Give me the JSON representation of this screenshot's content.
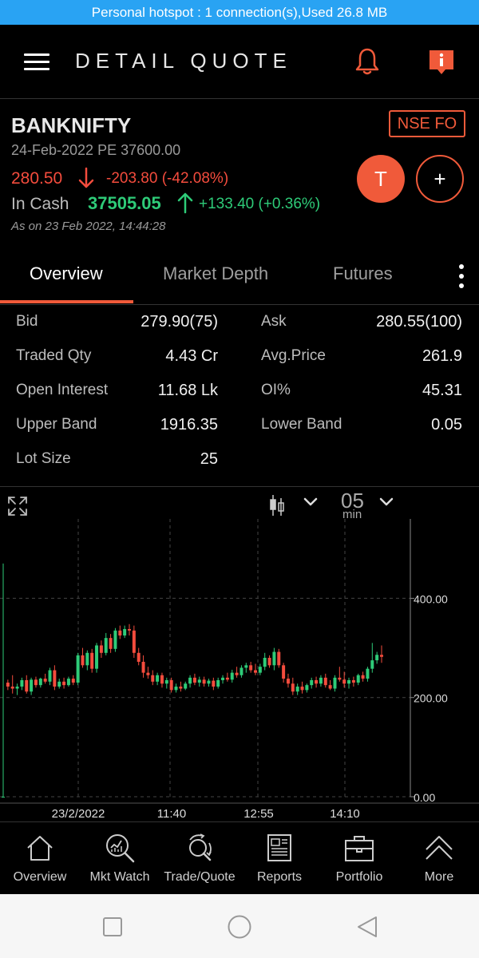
{
  "status_bar": {
    "text": "Personal hotspot : 1 connection(s),Used  26.8 MB"
  },
  "app_bar": {
    "title": "DETAIL QUOTE",
    "accent_color": "#f05a3a"
  },
  "quote": {
    "symbol": "BANKNIFTY",
    "contract": "24-Feb-2022 PE 37600.00",
    "exchange": "NSE FO",
    "ltp": "280.50",
    "ltp_change": "-203.80 (-42.08%)",
    "cash_label": "In Cash",
    "cash_price": "37505.05",
    "cash_change": "+133.40 (+0.36%)",
    "as_on": "As on 23 Feb 2022, 14:44:28",
    "trade_button": "T",
    "add_button": "+"
  },
  "tabs": [
    {
      "label": "Overview",
      "active": true
    },
    {
      "label": "Market Depth",
      "active": false
    },
    {
      "label": "Futures",
      "active": false
    }
  ],
  "stats": [
    {
      "l_label": "Bid",
      "l_value": "279.90(75)",
      "r_label": "Ask",
      "r_value": "280.55(100)"
    },
    {
      "l_label": "Traded Qty",
      "l_value": "4.43 Cr",
      "r_label": "Avg.Price",
      "r_value": "261.9"
    },
    {
      "l_label": "Open Interest",
      "l_value": "11.68 Lk",
      "r_label": "OI%",
      "r_value": "45.31"
    },
    {
      "l_label": "Upper Band",
      "l_value": "1916.35",
      "r_label": "Lower Band",
      "r_value": "0.05"
    },
    {
      "l_label": "Lot Size",
      "l_value": "25",
      "r_label": "",
      "r_value": ""
    }
  ],
  "chart_controls": {
    "interval": "05",
    "interval_unit": "min"
  },
  "chart_data": {
    "type": "candlestick",
    "y_ticks": [
      "400.00",
      "200.00",
      "0.00"
    ],
    "ylim": [
      0,
      560
    ],
    "x_tick_labels": [
      "23/2/2022",
      "11:40",
      "12:55",
      "14:10"
    ],
    "grid": true,
    "up_color": "#2ecb78",
    "down_color": "#f44c3d",
    "candles": [
      [
        0,
        470,
        0,
        0
      ],
      [
        230,
        236,
        215,
        222
      ],
      [
        222,
        245,
        208,
        218
      ],
      [
        218,
        228,
        205,
        222
      ],
      [
        222,
        240,
        215,
        235
      ],
      [
        235,
        245,
        208,
        212
      ],
      [
        212,
        240,
        205,
        236
      ],
      [
        236,
        242,
        220,
        225
      ],
      [
        225,
        240,
        220,
        238
      ],
      [
        238,
        248,
        228,
        232
      ],
      [
        232,
        260,
        225,
        255
      ],
      [
        255,
        265,
        215,
        222
      ],
      [
        222,
        238,
        218,
        232
      ],
      [
        232,
        240,
        218,
        225
      ],
      [
        225,
        242,
        222,
        238
      ],
      [
        238,
        245,
        225,
        230
      ],
      [
        230,
        290,
        225,
        285
      ],
      [
        285,
        300,
        260,
        265
      ],
      [
        265,
        295,
        255,
        290
      ],
      [
        290,
        298,
        250,
        258
      ],
      [
        258,
        310,
        250,
        305
      ],
      [
        305,
        315,
        280,
        290
      ],
      [
        290,
        330,
        285,
        320
      ],
      [
        320,
        328,
        290,
        298
      ],
      [
        298,
        340,
        292,
        335
      ],
      [
        335,
        345,
        318,
        325
      ],
      [
        325,
        345,
        320,
        338
      ],
      [
        338,
        348,
        325,
        335
      ],
      [
        335,
        345,
        280,
        290
      ],
      [
        290,
        300,
        265,
        272
      ],
      [
        272,
        285,
        240,
        250
      ],
      [
        250,
        262,
        238,
        245
      ],
      [
        245,
        255,
        225,
        232
      ],
      [
        232,
        250,
        225,
        245
      ],
      [
        245,
        250,
        220,
        228
      ],
      [
        228,
        240,
        218,
        235
      ],
      [
        235,
        240,
        210,
        215
      ],
      [
        215,
        228,
        210,
        222
      ],
      [
        222,
        232,
        212,
        218
      ],
      [
        218,
        232,
        215,
        228
      ],
      [
        228,
        245,
        220,
        240
      ],
      [
        240,
        248,
        225,
        230
      ],
      [
        230,
        242,
        222,
        236
      ],
      [
        236,
        242,
        222,
        228
      ],
      [
        228,
        238,
        222,
        234
      ],
      [
        234,
        240,
        215,
        222
      ],
      [
        222,
        240,
        218,
        235
      ],
      [
        235,
        245,
        228,
        240
      ],
      [
        240,
        250,
        232,
        236
      ],
      [
        236,
        256,
        230,
        250
      ],
      [
        250,
        262,
        240,
        245
      ],
      [
        245,
        265,
        240,
        260
      ],
      [
        260,
        270,
        250,
        265
      ],
      [
        265,
        272,
        250,
        255
      ],
      [
        255,
        268,
        245,
        250
      ],
      [
        250,
        268,
        245,
        262
      ],
      [
        262,
        290,
        255,
        280
      ],
      [
        280,
        285,
        260,
        265
      ],
      [
        265,
        300,
        255,
        292
      ],
      [
        292,
        298,
        260,
        265
      ],
      [
        265,
        270,
        230,
        238
      ],
      [
        238,
        248,
        220,
        228
      ],
      [
        228,
        240,
        205,
        212
      ],
      [
        212,
        228,
        205,
        222
      ],
      [
        222,
        232,
        208,
        215
      ],
      [
        215,
        228,
        210,
        225
      ],
      [
        225,
        240,
        218,
        235
      ],
      [
        235,
        242,
        220,
        228
      ],
      [
        228,
        245,
        222,
        240
      ],
      [
        240,
        248,
        220,
        225
      ],
      [
        225,
        235,
        215,
        218
      ],
      [
        218,
        245,
        212,
        240
      ],
      [
        240,
        262,
        232,
        236
      ],
      [
        236,
        252,
        220,
        228
      ],
      [
        228,
        240,
        218,
        235
      ],
      [
        235,
        242,
        222,
        230
      ],
      [
        230,
        248,
        225,
        245
      ],
      [
        245,
        252,
        232,
        238
      ],
      [
        238,
        262,
        232,
        258
      ],
      [
        258,
        310,
        250,
        275
      ],
      [
        275,
        292,
        268,
        286
      ],
      [
        286,
        305,
        270,
        282
      ]
    ]
  },
  "bottom_nav": [
    {
      "label": "Overview",
      "icon": "house-icon"
    },
    {
      "label": "Mkt Watch",
      "icon": "market-watch-icon"
    },
    {
      "label": "Trade/Quote",
      "icon": "trade-quote-icon"
    },
    {
      "label": "Reports",
      "icon": "reports-icon"
    },
    {
      "label": "Portfolio",
      "icon": "portfolio-icon"
    },
    {
      "label": "More",
      "icon": "more-icon"
    }
  ]
}
